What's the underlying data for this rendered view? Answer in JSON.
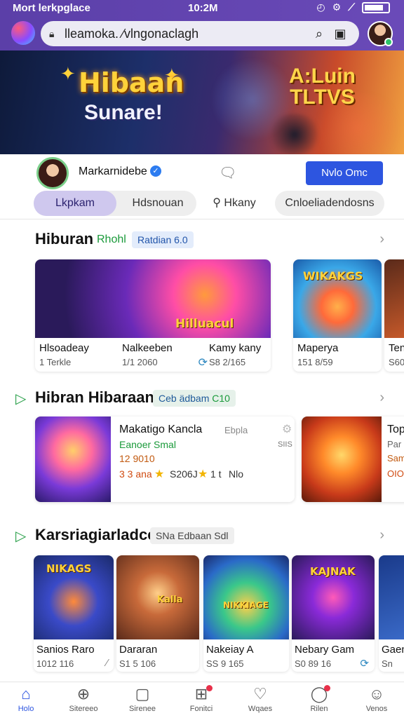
{
  "status_bar": {
    "carrier": "Mort lerkpglace",
    "time": "10:2M"
  },
  "browser": {
    "url": "lleamoka. ⁄vlngonaclagh"
  },
  "hero": {
    "title": "Hibaan",
    "subtitle": "Sunare!",
    "side_title_line1": "A:Luin",
    "side_title_line2": "TLTVS"
  },
  "profile": {
    "name": "Markarnidebe",
    "action_button": "Nvlo Omc"
  },
  "tabs": [
    {
      "label": "Lkpkam"
    },
    {
      "label": "Hdsnouan"
    },
    {
      "label": "Hkany"
    },
    {
      "label": "Cnloeliadendosns"
    }
  ],
  "section1": {
    "title": "Hiburan",
    "subtitle": "Rhohl",
    "chip": "Ratdian 6.0",
    "games": [
      {
        "name": "Hlsoadeay",
        "meta": "1 Terkle",
        "art_text": ""
      },
      {
        "name": "Nalkeeben",
        "meta": "1/1 2060",
        "art_text": "Hilluacul"
      },
      {
        "name": "Kamy kany",
        "meta": "S8 2/165",
        "art_text": ""
      },
      {
        "name": "Maperya",
        "meta": "151 8/59",
        "art_text": "WIKAKGS"
      },
      {
        "name": "Ten",
        "meta": "S60",
        "art_text": ""
      }
    ]
  },
  "section2": {
    "title": "Hibran Hibaraan",
    "chip": "Ceb ädbam",
    "chip_version": "C10",
    "featured": {
      "name": "Makatigo Kancla",
      "tag": "Ebpla",
      "subtitle": "Eanoer Smal",
      "meta": "12 9010",
      "rating": "3 3 ana",
      "rating_count": "S206J",
      "rating2": "1 t",
      "suffix": "Nlo",
      "side_code": "SIIS"
    },
    "second": {
      "name": "Top",
      "line2": "Par",
      "line3": "Sam",
      "line4": "OIO"
    }
  },
  "section3": {
    "title": "Karsriagiarladce",
    "chip": "SNa Edbaan",
    "chip_suffix": "Sdl",
    "games": [
      {
        "name": "Sanios Rarо",
        "meta": "1012 116",
        "art_text": "NIKAGS"
      },
      {
        "name": "Dararan",
        "meta": "S1 5 106",
        "art_text": "Kalla"
      },
      {
        "name": "Nakeiay A",
        "meta": "SS 9 165",
        "art_text": "NIKKIAGE"
      },
      {
        "name": "Nebary Gam",
        "meta": "S0 89 16",
        "art_text": "KAJNAK"
      },
      {
        "name": "Gaen",
        "meta": "Sn",
        "art_text": ""
      }
    ]
  },
  "bottom_nav": [
    {
      "label": "Holo",
      "icon": "home-icon"
    },
    {
      "label": "Sitereeo",
      "icon": "controller-icon"
    },
    {
      "label": "Sirenee",
      "icon": "square-icon"
    },
    {
      "label": "Fonitci",
      "icon": "gift-icon"
    },
    {
      "label": "Wqaes",
      "icon": "heart-icon"
    },
    {
      "label": "Rilen",
      "icon": "chat-icon"
    },
    {
      "label": "Venos",
      "icon": "user-icon"
    }
  ],
  "colors": {
    "header": "#5b3fa8",
    "accent": "#2d55e0",
    "green": "#1a9a3a"
  }
}
